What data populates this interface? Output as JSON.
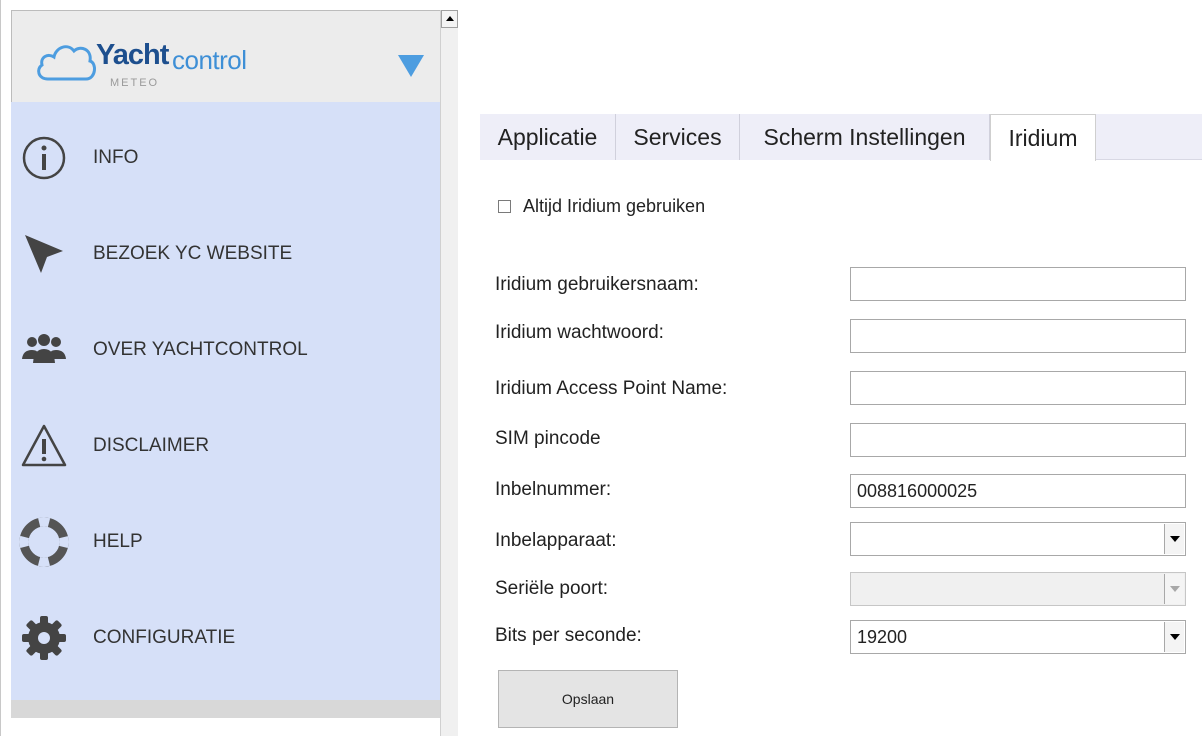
{
  "logo": {
    "brand_main": "Yacht",
    "brand_secondary": "control",
    "sub": "METEO"
  },
  "sidebar": {
    "items": [
      {
        "label": "INFO",
        "icon": "info-icon"
      },
      {
        "label": "BEZOEK YC WEBSITE",
        "icon": "cursor-arrow-icon"
      },
      {
        "label": "OVER YACHTCONTROL",
        "icon": "users-group-icon"
      },
      {
        "label": "DISCLAIMER",
        "icon": "warning-icon"
      },
      {
        "label": "HELP",
        "icon": "lifebuoy-icon"
      },
      {
        "label": "CONFIGURATIE",
        "icon": "gear-icon"
      }
    ]
  },
  "tabs": [
    {
      "label": "Applicatie",
      "active": false
    },
    {
      "label": "Services",
      "active": false
    },
    {
      "label": "Scherm Instellingen",
      "active": false
    },
    {
      "label": "Iridium",
      "active": true
    }
  ],
  "form": {
    "checkbox_label": "Altijd Iridium gebruiken",
    "checkbox_checked": false,
    "fields": [
      {
        "label": "Iridium gebruikersnaam:",
        "value": ""
      },
      {
        "label": "Iridium wachtwoord:",
        "value": ""
      },
      {
        "label": "Iridium Access Point Name:",
        "value": ""
      },
      {
        "label": "SIM pincode",
        "value": ""
      },
      {
        "label": "Inbelnummer:",
        "value": "008816000025"
      }
    ],
    "selects": [
      {
        "label": "Inbelapparaat:",
        "value": "",
        "disabled": false
      },
      {
        "label": "Seriële poort:",
        "value": "",
        "disabled": true
      },
      {
        "label": "Bits per seconde:",
        "value": "19200",
        "disabled": false
      }
    ],
    "save_label": "Opslaan"
  },
  "colors": {
    "menu_bg": "#d6e0f8",
    "logo_dark": "#1d4f8e",
    "logo_light": "#3e8fd6",
    "dropdown_arrow": "#4d9de0",
    "tabbar_bg": "#eeeef8"
  }
}
